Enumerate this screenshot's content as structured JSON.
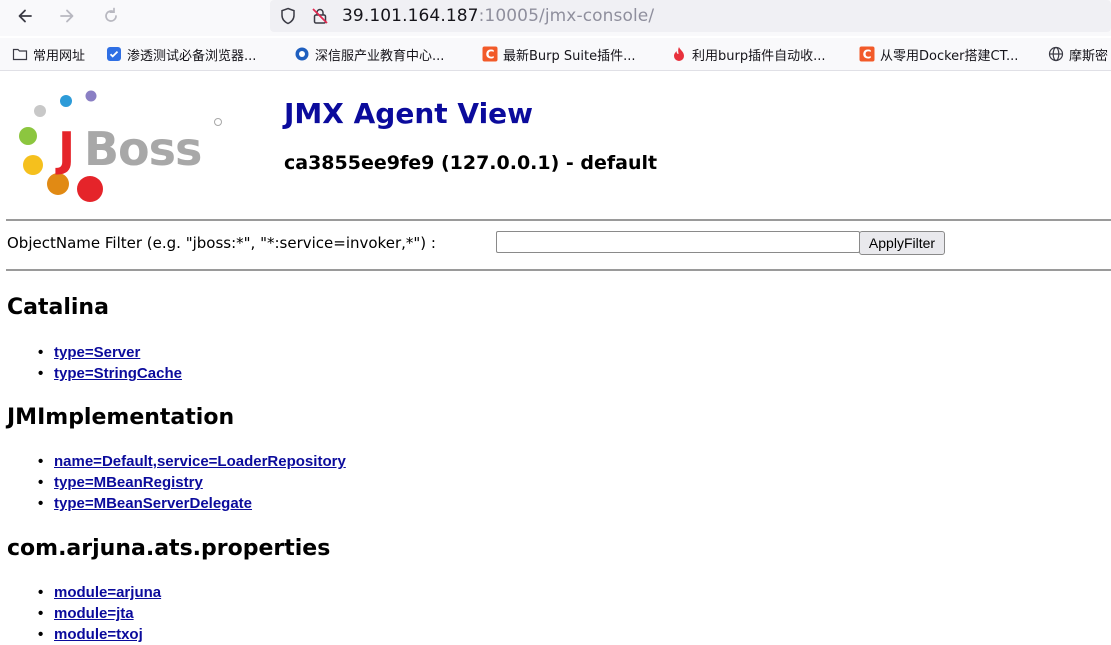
{
  "browser": {
    "url_host": "39.101.164.187",
    "url_rest": ":10005/jmx-console/",
    "icons": {
      "back": "back-arrow-icon",
      "forward": "forward-arrow-icon",
      "reload": "reload-icon",
      "shield": "shield-icon",
      "insecure": "insecure-lock-icon"
    }
  },
  "bookmarks": [
    {
      "label": "常用网址",
      "icon": "folder-icon"
    },
    {
      "label": "渗透测试必备浏览器...",
      "icon": "shield-check-icon"
    },
    {
      "label": "深信服产业教育中心...",
      "icon": "globe-icon"
    },
    {
      "label": "最新Burp Suite插件...",
      "icon": "csdn-icon"
    },
    {
      "label": "利用burp插件自动收...",
      "icon": "flame-icon"
    },
    {
      "label": "从零用Docker搭建CT...",
      "icon": "csdn-icon"
    },
    {
      "label": "摩斯密",
      "icon": "globe-icon"
    }
  ],
  "page": {
    "title": "JMX Agent View",
    "subtitle": "ca3855ee9fe9 (127.0.0.1) - default",
    "logo_text": "JBoss"
  },
  "filter": {
    "label": "ObjectName Filter (e.g. \"jboss:*\", \"*:service=invoker,*\") :",
    "value": "",
    "button": "ApplyFilter"
  },
  "domains": [
    {
      "name": "Catalina",
      "mbeans": [
        "type=Server",
        "type=StringCache"
      ]
    },
    {
      "name": "JMImplementation",
      "mbeans": [
        "name=Default,service=LoaderRepository",
        "type=MBeanRegistry",
        "type=MBeanServerDelegate"
      ]
    },
    {
      "name": "com.arjuna.ats.properties",
      "mbeans": [
        "module=arjuna",
        "module=jta",
        "module=txoj"
      ]
    }
  ],
  "colors": {
    "title": "#0b0b9c",
    "link": "#0b0b9c",
    "logo_red": "#e5242a"
  }
}
